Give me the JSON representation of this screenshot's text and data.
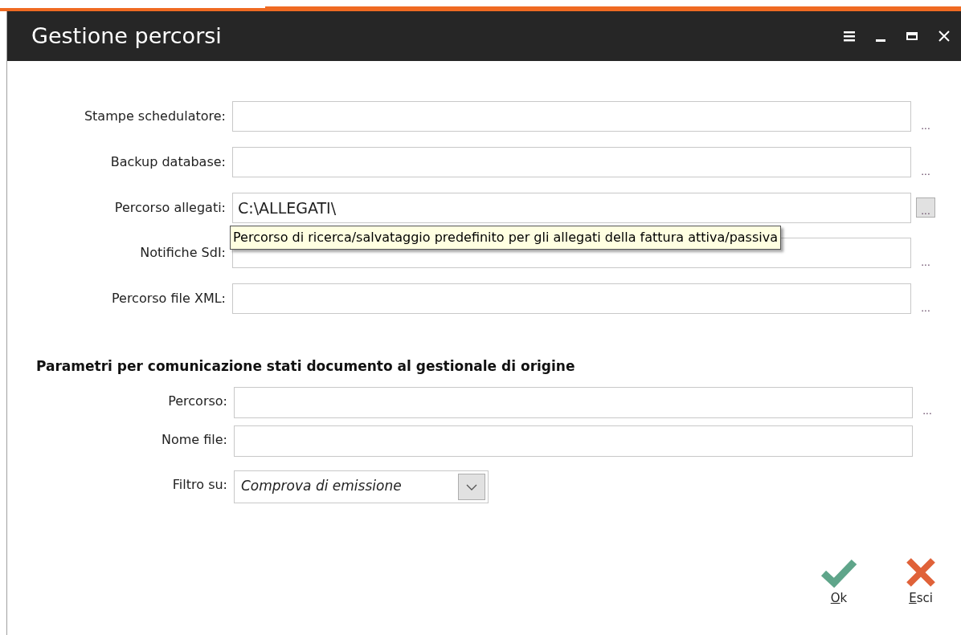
{
  "window": {
    "title": "Gestione percorsi",
    "controls": [
      {
        "kind": "menu"
      },
      {
        "kind": "minimize"
      },
      {
        "kind": "maximize"
      },
      {
        "kind": "close"
      }
    ]
  },
  "fields": [
    {
      "label": "Stampe schedulatore:",
      "browse": "...",
      "hovered": false
    },
    {
      "label": "Backup database:",
      "browse": "...",
      "hovered": false
    },
    {
      "label": "Percorso allegati:",
      "value": "C:\\ALLEGATI\\",
      "browse": "...",
      "hovered": true
    },
    {
      "label": "Notifiche SdI:",
      "browse": "...",
      "hovered": false
    },
    {
      "label": "Percorso file XML:",
      "browse": "...",
      "hovered": false
    }
  ],
  "tooltip": "Percorso di ricerca/salvataggio predefinito per gli allegati della fattura attiva/passiva",
  "section": {
    "title": "Parametri per comunicazione stati documento al gestionale di origine",
    "fields": [
      {
        "kind": "text",
        "label": "Percorso:",
        "browse": "..."
      },
      {
        "kind": "text",
        "label": "Nome file:"
      },
      {
        "kind": "combo",
        "label": "Filtro su:",
        "value": "Comprova di emissione"
      }
    ]
  },
  "buttons": [
    {
      "kind": "ok",
      "label": "Ok"
    },
    {
      "kind": "cancel",
      "label": "Esci"
    }
  ]
}
